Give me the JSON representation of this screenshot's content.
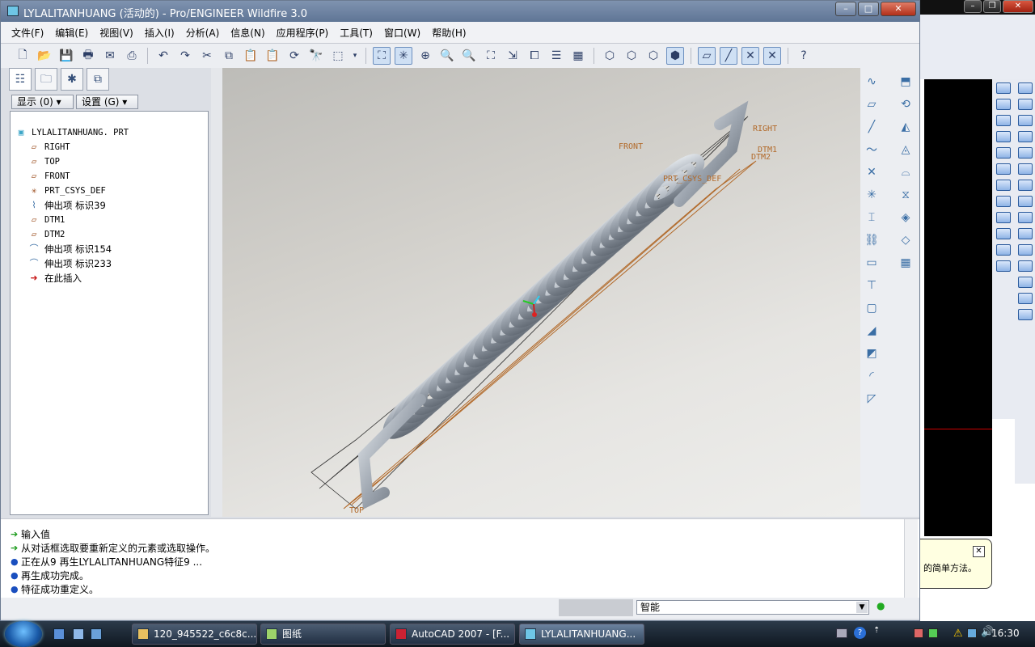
{
  "window": {
    "title": "LYLALITANHUANG (活动的) - Pro/ENGINEER Wildfire 3.0"
  },
  "menu": [
    "文件(F)",
    "编辑(E)",
    "视图(V)",
    "插入(I)",
    "分析(A)",
    "信息(N)",
    "应用程序(P)",
    "工具(T)",
    "窗口(W)",
    "帮助(H)"
  ],
  "nav": {
    "show_btn": "显示 (0)",
    "settings_btn": "设置 (G)"
  },
  "tree": [
    {
      "label": "LYLALITANHUANG. PRT",
      "icon": "part-icon"
    },
    {
      "label": "RIGHT",
      "icon": "datum-plane-icon"
    },
    {
      "label": "TOP",
      "icon": "datum-plane-icon"
    },
    {
      "label": "FRONT",
      "icon": "datum-plane-icon"
    },
    {
      "label": "PRT_CSYS_DEF",
      "icon": "csys-icon"
    },
    {
      "label": "伸出项 标识39",
      "icon": "helical-sweep-icon"
    },
    {
      "label": "DTM1",
      "icon": "datum-plane-icon"
    },
    {
      "label": "DTM2",
      "icon": "datum-plane-icon"
    },
    {
      "label": "伸出项 标识154",
      "icon": "sweep-icon"
    },
    {
      "label": "伸出项 标识233",
      "icon": "sweep-icon"
    },
    {
      "label": "在此插入",
      "icon": "insert-arrow-icon"
    }
  ],
  "model_labels": {
    "right": "RIGHT",
    "front": "FRONT",
    "dtm1": "DTM1",
    "dtm2": "DTM2",
    "csys": "PRT_CSYS_DEF",
    "top": "TOP"
  },
  "messages": [
    {
      "text": "输入值",
      "icon": "arrow"
    },
    {
      "text": "从对话框选取要重新定义的元素或选取操作。",
      "icon": "arrow"
    },
    {
      "text": "正在从9 再生LYLALITANHUANG特征9 ...",
      "icon": "dot"
    },
    {
      "text": "再生成功完成。",
      "icon": "dot"
    },
    {
      "text": "特征成功重定义。",
      "icon": "dot"
    }
  ],
  "status": {
    "filter": "智能"
  },
  "tooltip": {
    "text": "的简单方法。"
  },
  "taskbar": {
    "items": [
      "120_945522_c6c8c...",
      "图纸",
      "AutoCAD 2007 - [F...",
      "LYLALITANHUANG..."
    ],
    "clock": "16:30"
  }
}
